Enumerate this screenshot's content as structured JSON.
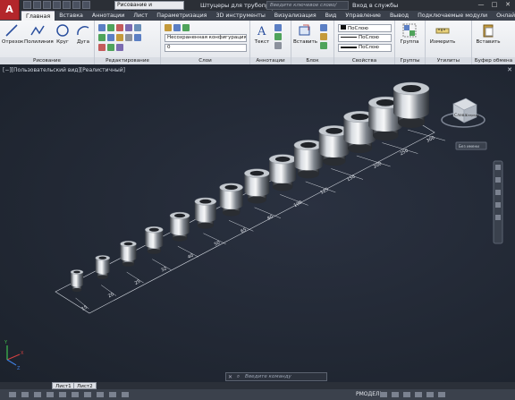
{
  "app": {
    "logo_letter": "A",
    "workspace": "Рисование и аннотации",
    "document_title": "Штуцеры для трубопрово...",
    "search_placeholder": "Введите ключевое слово/фразу",
    "signin": "Вход в службы",
    "window_controls": [
      "—",
      "□",
      "✕"
    ]
  },
  "tabs": [
    {
      "label": "Главная",
      "active": true
    },
    {
      "label": "Вставка"
    },
    {
      "label": "Аннотации"
    },
    {
      "label": "Лист"
    },
    {
      "label": "Параметризация"
    },
    {
      "label": "3D инструменты"
    },
    {
      "label": "Визуализация"
    },
    {
      "label": "Вид"
    },
    {
      "label": "Управление"
    },
    {
      "label": "Вывод"
    },
    {
      "label": "Подключаемые модули"
    },
    {
      "label": "Онлайн"
    }
  ],
  "ribbon": {
    "draw": {
      "title": "Рисование",
      "tools": [
        "Отрезок",
        "Полилиния",
        "Круг",
        "Дуга"
      ]
    },
    "modify": {
      "title": "Редактирование"
    },
    "layers": {
      "title": "Слои",
      "layer_state": "Несохраненная конфигурация сло",
      "layer_current": "0"
    },
    "annotation": {
      "title": "Аннотации",
      "tool": "Текст"
    },
    "block": {
      "title": "Блок",
      "tool": "Вставить"
    },
    "properties": {
      "title": "Свойства",
      "color": "ПоСлою",
      "linetype": "ПоСлою",
      "lineweight": "ПоСлою"
    },
    "groups": {
      "title": "Группы",
      "tool": "Группа"
    },
    "utilities": {
      "title": "Утилиты",
      "tool": "Измерить"
    },
    "clipboard": {
      "title": "Буфер обмена",
      "tool": "Вставить"
    }
  },
  "viewport": {
    "label": "[−][Пользовательский вид][Реалистичный]",
    "viewcube_face": "Слева",
    "viewcube_side": "Спереди",
    "viewcube_menu": "Без имени",
    "fittings": [
      {
        "size": "15"
      },
      {
        "size": "20"
      },
      {
        "size": "25"
      },
      {
        "size": "32"
      },
      {
        "size": "40"
      },
      {
        "size": "50"
      },
      {
        "size": "65"
      },
      {
        "size": "80"
      },
      {
        "size": "100"
      },
      {
        "size": "125"
      },
      {
        "size": "150"
      },
      {
        "size": "200"
      },
      {
        "size": "250"
      },
      {
        "size": "300"
      }
    ],
    "axis_labels": {
      "x": "X",
      "y": "Y",
      "z": "Z"
    }
  },
  "command_line": {
    "prompt": "Введите команду"
  },
  "layout_tabs": [
    "Лист1",
    "Лист2"
  ],
  "status": {
    "space": "РМОДЕЛЬ"
  }
}
